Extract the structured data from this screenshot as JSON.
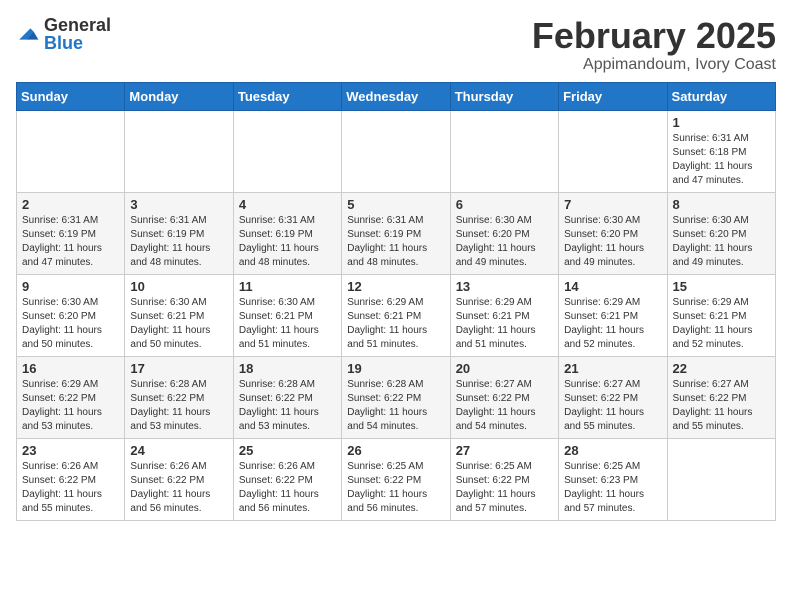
{
  "header": {
    "logo_general": "General",
    "logo_blue": "Blue",
    "month_title": "February 2025",
    "location": "Appimandoum, Ivory Coast"
  },
  "days_of_week": [
    "Sunday",
    "Monday",
    "Tuesday",
    "Wednesday",
    "Thursday",
    "Friday",
    "Saturday"
  ],
  "weeks": [
    [
      {
        "day": "",
        "text": ""
      },
      {
        "day": "",
        "text": ""
      },
      {
        "day": "",
        "text": ""
      },
      {
        "day": "",
        "text": ""
      },
      {
        "day": "",
        "text": ""
      },
      {
        "day": "",
        "text": ""
      },
      {
        "day": "1",
        "text": "Sunrise: 6:31 AM\nSunset: 6:18 PM\nDaylight: 11 hours\nand 47 minutes."
      }
    ],
    [
      {
        "day": "2",
        "text": "Sunrise: 6:31 AM\nSunset: 6:19 PM\nDaylight: 11 hours\nand 47 minutes."
      },
      {
        "day": "3",
        "text": "Sunrise: 6:31 AM\nSunset: 6:19 PM\nDaylight: 11 hours\nand 48 minutes."
      },
      {
        "day": "4",
        "text": "Sunrise: 6:31 AM\nSunset: 6:19 PM\nDaylight: 11 hours\nand 48 minutes."
      },
      {
        "day": "5",
        "text": "Sunrise: 6:31 AM\nSunset: 6:19 PM\nDaylight: 11 hours\nand 48 minutes."
      },
      {
        "day": "6",
        "text": "Sunrise: 6:30 AM\nSunset: 6:20 PM\nDaylight: 11 hours\nand 49 minutes."
      },
      {
        "day": "7",
        "text": "Sunrise: 6:30 AM\nSunset: 6:20 PM\nDaylight: 11 hours\nand 49 minutes."
      },
      {
        "day": "8",
        "text": "Sunrise: 6:30 AM\nSunset: 6:20 PM\nDaylight: 11 hours\nand 49 minutes."
      }
    ],
    [
      {
        "day": "9",
        "text": "Sunrise: 6:30 AM\nSunset: 6:20 PM\nDaylight: 11 hours\nand 50 minutes."
      },
      {
        "day": "10",
        "text": "Sunrise: 6:30 AM\nSunset: 6:21 PM\nDaylight: 11 hours\nand 50 minutes."
      },
      {
        "day": "11",
        "text": "Sunrise: 6:30 AM\nSunset: 6:21 PM\nDaylight: 11 hours\nand 51 minutes."
      },
      {
        "day": "12",
        "text": "Sunrise: 6:29 AM\nSunset: 6:21 PM\nDaylight: 11 hours\nand 51 minutes."
      },
      {
        "day": "13",
        "text": "Sunrise: 6:29 AM\nSunset: 6:21 PM\nDaylight: 11 hours\nand 51 minutes."
      },
      {
        "day": "14",
        "text": "Sunrise: 6:29 AM\nSunset: 6:21 PM\nDaylight: 11 hours\nand 52 minutes."
      },
      {
        "day": "15",
        "text": "Sunrise: 6:29 AM\nSunset: 6:21 PM\nDaylight: 11 hours\nand 52 minutes."
      }
    ],
    [
      {
        "day": "16",
        "text": "Sunrise: 6:29 AM\nSunset: 6:22 PM\nDaylight: 11 hours\nand 53 minutes."
      },
      {
        "day": "17",
        "text": "Sunrise: 6:28 AM\nSunset: 6:22 PM\nDaylight: 11 hours\nand 53 minutes."
      },
      {
        "day": "18",
        "text": "Sunrise: 6:28 AM\nSunset: 6:22 PM\nDaylight: 11 hours\nand 53 minutes."
      },
      {
        "day": "19",
        "text": "Sunrise: 6:28 AM\nSunset: 6:22 PM\nDaylight: 11 hours\nand 54 minutes."
      },
      {
        "day": "20",
        "text": "Sunrise: 6:27 AM\nSunset: 6:22 PM\nDaylight: 11 hours\nand 54 minutes."
      },
      {
        "day": "21",
        "text": "Sunrise: 6:27 AM\nSunset: 6:22 PM\nDaylight: 11 hours\nand 55 minutes."
      },
      {
        "day": "22",
        "text": "Sunrise: 6:27 AM\nSunset: 6:22 PM\nDaylight: 11 hours\nand 55 minutes."
      }
    ],
    [
      {
        "day": "23",
        "text": "Sunrise: 6:26 AM\nSunset: 6:22 PM\nDaylight: 11 hours\nand 55 minutes."
      },
      {
        "day": "24",
        "text": "Sunrise: 6:26 AM\nSunset: 6:22 PM\nDaylight: 11 hours\nand 56 minutes."
      },
      {
        "day": "25",
        "text": "Sunrise: 6:26 AM\nSunset: 6:22 PM\nDaylight: 11 hours\nand 56 minutes."
      },
      {
        "day": "26",
        "text": "Sunrise: 6:25 AM\nSunset: 6:22 PM\nDaylight: 11 hours\nand 56 minutes."
      },
      {
        "day": "27",
        "text": "Sunrise: 6:25 AM\nSunset: 6:22 PM\nDaylight: 11 hours\nand 57 minutes."
      },
      {
        "day": "28",
        "text": "Sunrise: 6:25 AM\nSunset: 6:23 PM\nDaylight: 11 hours\nand 57 minutes."
      },
      {
        "day": "",
        "text": ""
      }
    ]
  ]
}
